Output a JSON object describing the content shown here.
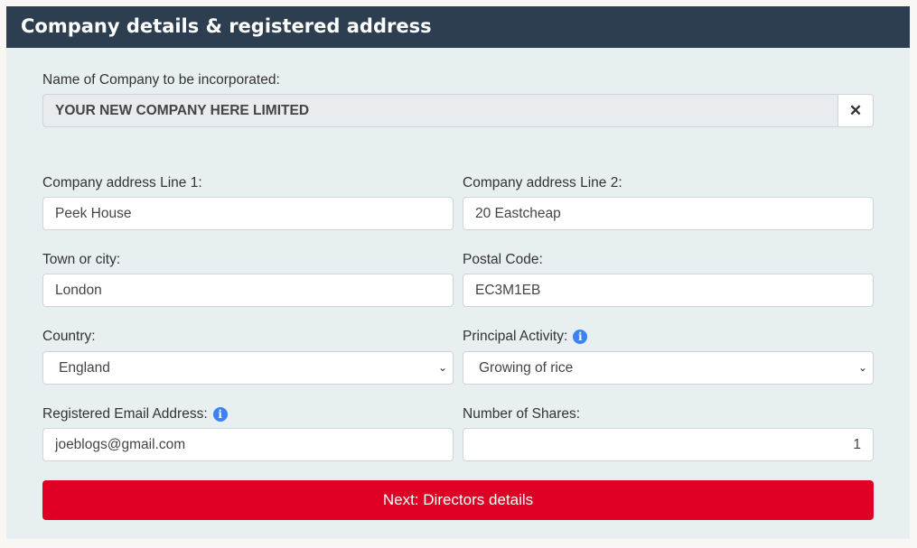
{
  "header": {
    "title": "Company details & registered address"
  },
  "company_name": {
    "label": "Name of Company to be incorporated:",
    "value": "YOUR NEW COMPANY HERE LIMITED",
    "clear_icon": "close-icon"
  },
  "address1": {
    "label": "Company address Line 1:",
    "value": "Peek House"
  },
  "address2": {
    "label": "Company address Line 2:",
    "value": "20 Eastcheap"
  },
  "town": {
    "label": "Town or city:",
    "value": "London"
  },
  "postal": {
    "label": "Postal Code:",
    "value": "EC3M1EB"
  },
  "country": {
    "label": "Country:",
    "value": "England"
  },
  "activity": {
    "label": "Principal Activity:",
    "value": "Growing of rice",
    "icon": "info-icon"
  },
  "email": {
    "label": "Registered Email Address:",
    "value": "joeblogs@gmail.com",
    "icon": "info-icon"
  },
  "shares": {
    "label": "Number of Shares:",
    "value": "1"
  },
  "next_button": {
    "label": "Next: Directors details",
    "color": "#e00025"
  },
  "colors": {
    "header": "#2d3e50",
    "panel": "#e8eff1",
    "info": "#3b82f6"
  }
}
